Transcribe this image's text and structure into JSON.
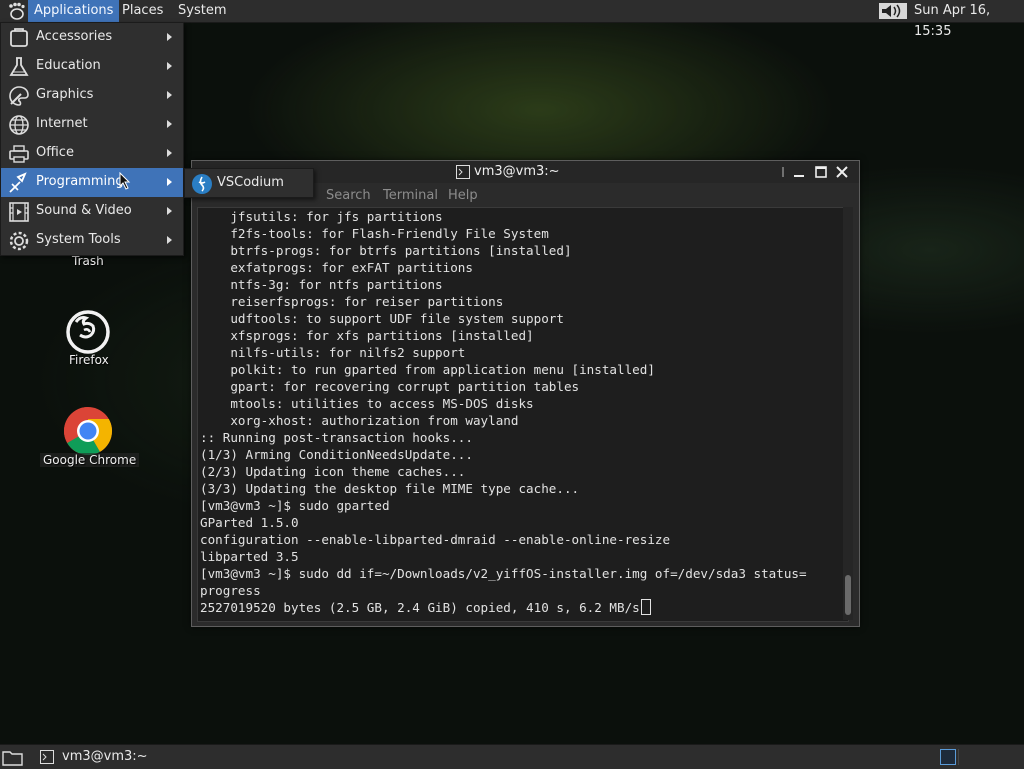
{
  "top_panel": {
    "applications": "Applications",
    "places": "Places",
    "system": "System",
    "clock": "Sun Apr 16, 15:35"
  },
  "apps_menu": {
    "items": [
      {
        "label": "Accessories",
        "icon": "accessories-icon"
      },
      {
        "label": "Education",
        "icon": "education-flask-icon"
      },
      {
        "label": "Graphics",
        "icon": "graphics-palette-icon"
      },
      {
        "label": "Internet",
        "icon": "internet-globe-icon"
      },
      {
        "label": "Office",
        "icon": "office-printer-icon"
      },
      {
        "label": "Programming",
        "icon": "programming-icon"
      },
      {
        "label": "Sound & Video",
        "icon": "sound-video-icon"
      },
      {
        "label": "System Tools",
        "icon": "system-tools-gear-icon"
      }
    ],
    "active_index": 5,
    "submenu": {
      "label": "VSCodium",
      "icon": "vscodium-icon"
    }
  },
  "desktop": {
    "trash_label": "Trash",
    "firefox_label": "Firefox",
    "chrome_label": "Google Chrome"
  },
  "terminal": {
    "title": "vm3@vm3:~",
    "menus": [
      "Search",
      "Terminal",
      "Help"
    ],
    "lines": [
      "    jfsutils: for jfs partitions",
      "    f2fs-tools: for Flash-Friendly File System",
      "    btrfs-progs: for btrfs partitions [installed]",
      "    exfatprogs: for exFAT partitions",
      "    ntfs-3g: for ntfs partitions",
      "    reiserfsprogs: for reiser partitions",
      "    udftools: to support UDF file system support",
      "    xfsprogs: for xfs partitions [installed]",
      "    nilfs-utils: for nilfs2 support",
      "    polkit: to run gparted from application menu [installed]",
      "    gpart: for recovering corrupt partition tables",
      "    mtools: utilities to access MS-DOS disks",
      "    xorg-xhost: authorization from wayland",
      ":: Running post-transaction hooks...",
      "(1/3) Arming ConditionNeedsUpdate...",
      "(2/3) Updating icon theme caches...",
      "(3/3) Updating the desktop file MIME type cache...",
      "[vm3@vm3 ~]$ sudo gparted",
      "GParted 1.5.0",
      "configuration --enable-libparted-dmraid --enable-online-resize",
      "libparted 3.5",
      "[vm3@vm3 ~]$ sudo dd if=~/Downloads/v2_yiffOS-installer.img of=/dev/sda3 status=",
      "progress"
    ],
    "last_line": "2527019520 bytes (2.5 GB, 2.4 GiB) copied, 410 s, 6.2 MB/s"
  },
  "bottom_panel": {
    "taskbar_label": "vm3@vm3:~"
  }
}
